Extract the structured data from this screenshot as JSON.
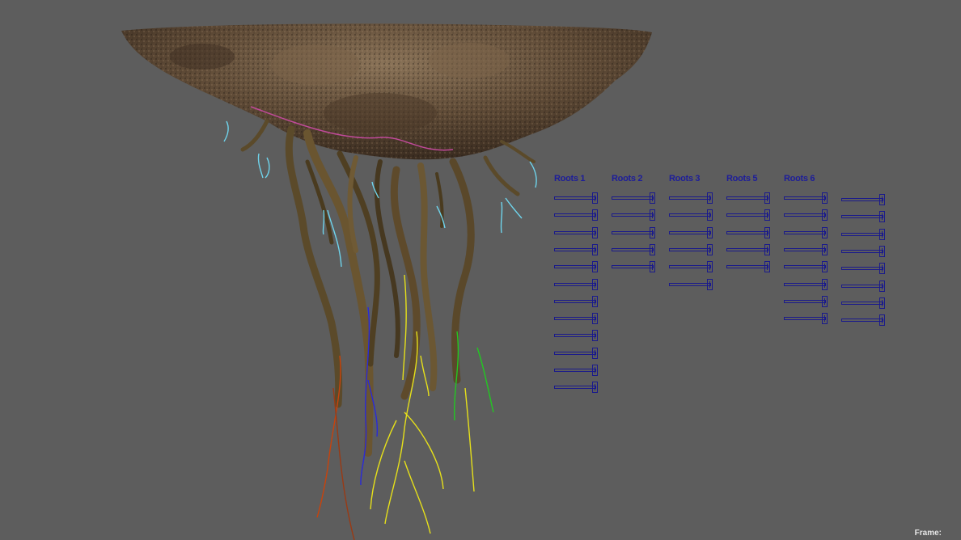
{
  "viewport": {
    "background": "#5d5d5d",
    "scene_object": "floating-island-with-roots",
    "controls_color": "#1a1a8c"
  },
  "control_columns": [
    {
      "label": "Roots 1",
      "slider_count": 12
    },
    {
      "label": "Roots 2",
      "slider_count": 5
    },
    {
      "label": "Roots 3",
      "slider_count": 6
    },
    {
      "label": "Roots 5",
      "slider_count": 5
    },
    {
      "label": "Roots 6",
      "slider_count": 8
    },
    {
      "label": "",
      "slider_count": 8
    }
  ],
  "hud": {
    "frame_label": "Frame:"
  }
}
